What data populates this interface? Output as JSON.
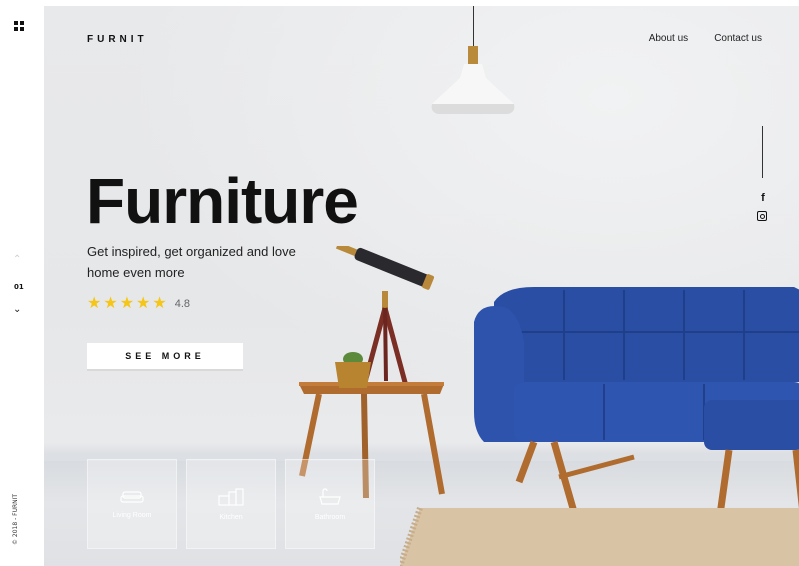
{
  "brand": "FURNIT",
  "nav": {
    "about": "About us",
    "contact": "Contact us"
  },
  "hero": {
    "title": "Furniture",
    "subtitle": "Get inspired, get organized and love home even more",
    "rating": "4.8",
    "stars": 5,
    "cta": "SEE MORE"
  },
  "categories": [
    {
      "label": "Living Room",
      "icon": "sofa-icon"
    },
    {
      "label": "Kitchen",
      "icon": "kitchen-icon"
    },
    {
      "label": "Bathroom",
      "icon": "bathtub-icon"
    }
  ],
  "slider": {
    "current": "01"
  },
  "footer": {
    "copyright": "© 2018 - FURNIT"
  },
  "social": {
    "facebook": "f"
  },
  "colors": {
    "accent": "#f5c518",
    "sofa": "#2a4ea3"
  }
}
